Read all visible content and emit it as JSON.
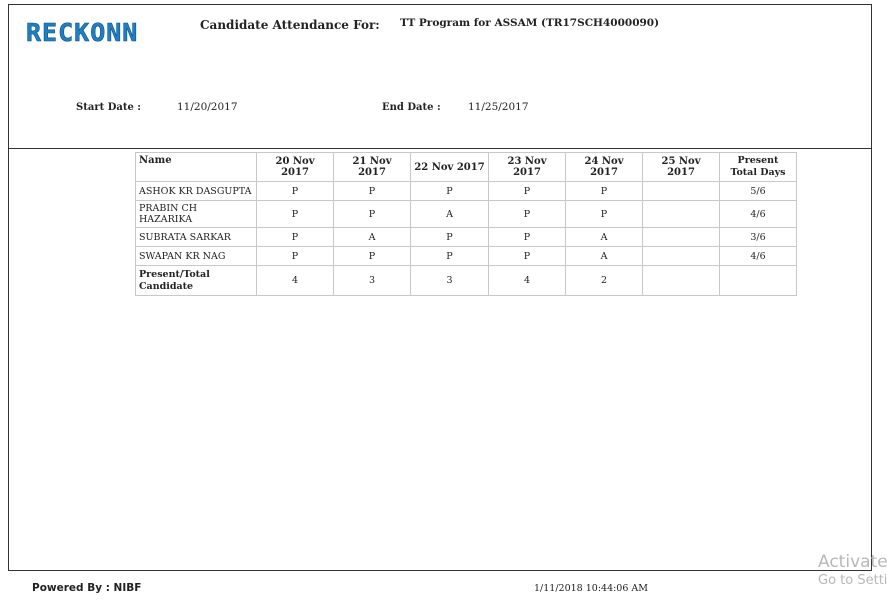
{
  "header": {
    "logo": "RECKONN",
    "title_label": "Candidate Attendance For:",
    "program": "TT Program for ASSAM (TR17SCH4000090)",
    "start_date_label": "Start Date :",
    "start_date": "11/20/2017",
    "end_date_label": "End Date :",
    "end_date": "11/25/2017"
  },
  "table": {
    "columns": [
      "Name",
      "20 Nov 2017",
      "21 Nov 2017",
      "22 Nov 2017",
      "23 Nov 2017",
      "24 Nov 2017",
      "25 Nov 2017",
      "Present Total Days"
    ],
    "rows": [
      [
        "ASHOK KR DASGUPTA",
        "P",
        "P",
        "P",
        "P",
        "P",
        "",
        "5/6"
      ],
      [
        "PRABIN CH HAZARIKA",
        "P",
        "P",
        "A",
        "P",
        "P",
        "",
        "4/6"
      ],
      [
        "SUBRATA SARKAR",
        "P",
        "A",
        "P",
        "P",
        "A",
        "",
        "3/6"
      ],
      [
        "SWAPAN KR NAG",
        "P",
        "P",
        "P",
        "P",
        "A",
        "",
        "4/6"
      ]
    ],
    "summary": [
      "Present/Total Candidate",
      "4",
      "3",
      "3",
      "4",
      "2",
      "",
      ""
    ]
  },
  "footer": {
    "powered_by": "Powered By : NIBF",
    "timestamp": "1/11/2018 10:44:06 AM"
  },
  "watermark": {
    "line1": "Activate",
    "line2": "Go to Setti"
  }
}
